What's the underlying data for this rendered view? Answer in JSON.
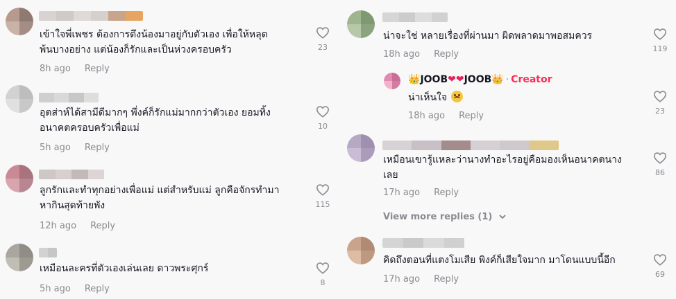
{
  "left": [
    {
      "text_lines": [
        "เข้าใจพี่เพชร ต้องการดึงน้องมาอยู่กับตัวเอง เพื่อให้หลุด",
        "พ้นบางอย่าง แต่น้องก็รักและเป็นห่วงครอบครัว"
      ],
      "time": "8h ago",
      "reply": "Reply",
      "likes": "23",
      "avatar_colors": [
        "#b69a8f",
        "#8f7a72",
        "#c9b3a6",
        "#a48d84"
      ],
      "name_colors": [
        "#d8d2d0",
        "#cfcac8",
        "#e0dad6",
        "#d6d0cd",
        "#c8a48a",
        "#e8a560"
      ]
    },
    {
      "text_lines": [
        "อุตส่าห์ได้สามีดีมากๆ พึ่งค์ก็รักแม่มากกว่าตัวเอง ยอมทิ้ง",
        "อนาคตครอบครัวเพื่อแม่"
      ],
      "time": "5h ago",
      "reply": "Reply",
      "likes": "10",
      "avatar_colors": [
        "#d2d2d2",
        "#bdbdbd",
        "#e0e0e0",
        "#c8c8c8"
      ],
      "name_colors": [
        "#cfcfcf",
        "#d9d9d9",
        "#c7c7c7",
        "#dedede"
      ]
    },
    {
      "text_lines": [
        "ลูกรักและทำทุกอย่างเพื่อแม่ แต่สำหรับแม่ ลูกคือจักรทำมา",
        "หากินสุดท้ายพัง"
      ],
      "time": "12h ago",
      "reply": "Reply",
      "likes": "115",
      "avatar_colors": [
        "#c98a95",
        "#a8737d",
        "#d9a4ad",
        "#b88690"
      ],
      "name_colors": [
        "#cfc6c6",
        "#d8d0d0",
        "#c3b9b9",
        "#ddd5d5"
      ]
    },
    {
      "text_lines": [
        "เหมือนละครที่ตัวเองเล่นเลย ดาวพระศุกร์"
      ],
      "time": "5h ago",
      "reply": "Reply",
      "likes": "8",
      "avatar_colors": [
        "#a8a69e",
        "#8f8d86",
        "#c0bdb5",
        "#9d9a92"
      ],
      "name_colors": [
        "#d2d2d2",
        "#c6c6c6"
      ]
    }
  ],
  "right": {
    "c1": {
      "text_lines": [
        "น่าจะใช่ หลายเรื่องที่ผ่านมา ผิดพลาดมาพอสมควร"
      ],
      "time": "18h ago",
      "reply": "Reply",
      "likes": "119",
      "avatar_colors": [
        "#9fb58f",
        "#7f9a72",
        "#b6c8a8",
        "#8aa57e"
      ],
      "name_colors": [
        "#d6d6d6",
        "#cccccc",
        "#dddddd",
        "#d1d1d1"
      ]
    },
    "creator_reply": {
      "name_parts": [
        "👑",
        "JOOB",
        "❤",
        "❤",
        "JOOB",
        "👑"
      ],
      "dot": "·",
      "badge": "Creator",
      "text": "น่าเห็นใจ",
      "time": "18h ago",
      "reply": "Reply",
      "likes": "23",
      "avatar_colors": [
        "#e48ab0",
        "#c76f96",
        "#f0b3cb",
        "#d27da2"
      ]
    },
    "c2": {
      "text_lines": [
        "เหมือนเขารู้แหละว่านางทำอะไรอยู่คือมองเห็นอนาคตนาง",
        "เลย"
      ],
      "time": "17h ago",
      "reply": "Reply",
      "likes": "86",
      "avatar_colors": [
        "#b6a9c4",
        "#9f8fb0",
        "#c9bdd5",
        "#ab9cbb"
      ],
      "name_colors": [
        "#d7d2d6",
        "#c9bfc7",
        "#a58c8c",
        "#d6cfd3",
        "#cfc9cd",
        "#e0c88a"
      ]
    },
    "view_more": "View more replies (1)",
    "c3": {
      "text_lines": [
        "คิดถึงตอนที่แตงโมเสีย พิงค์ก็เสียใจมาก มาโดนแบบนี้อีก"
      ],
      "time": "17h ago",
      "reply": "Reply",
      "likes": "69",
      "avatar_colors": [
        "#c9a38a",
        "#b08a72",
        "#dcbca5",
        "#bf9880"
      ],
      "name_colors": [
        "#d4d4d4",
        "#cacaca",
        "#dadada",
        "#d0d0d0"
      ]
    }
  }
}
